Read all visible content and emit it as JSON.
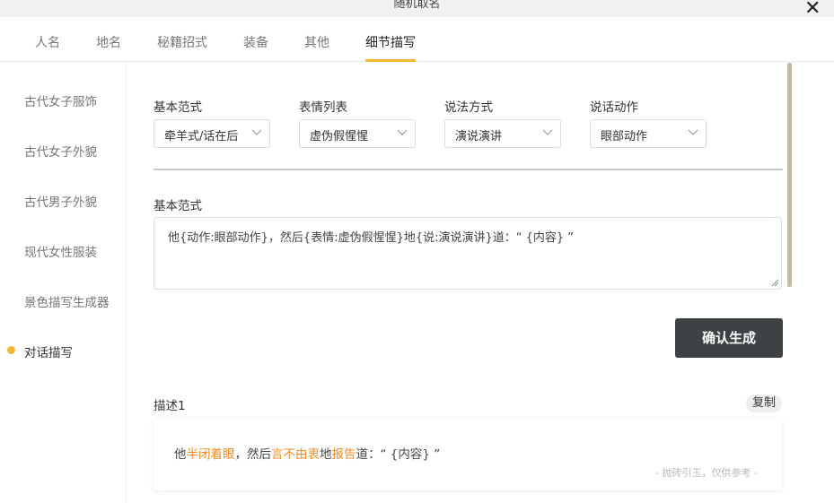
{
  "window": {
    "title": "随机取名",
    "close_glyph": "✕"
  },
  "tabs": [
    {
      "label": "人名"
    },
    {
      "label": "地名"
    },
    {
      "label": "秘籍招式"
    },
    {
      "label": "装备"
    },
    {
      "label": "其他"
    },
    {
      "label": "细节描写",
      "active": true
    }
  ],
  "sidebar": {
    "items": [
      {
        "label": "古代女子服饰"
      },
      {
        "label": "古代女子外貌"
      },
      {
        "label": "古代男子外貌"
      },
      {
        "label": "现代女性服装"
      },
      {
        "label": "景色描写生成器"
      },
      {
        "label": "对话描写",
        "active": true
      }
    ]
  },
  "form": {
    "fields": [
      {
        "label": "基本范式",
        "value": "牵羊式/话在后"
      },
      {
        "label": "表情列表",
        "value": "虚伪假惺惺"
      },
      {
        "label": "说法方式",
        "value": "演说演讲"
      },
      {
        "label": "说话动作",
        "value": "眼部动作"
      }
    ],
    "template_label": "基本范式",
    "template_value": "他{动作:眼部动作}，然后{表情:虚伪假惺惺}地{说:演说演讲}道：“ {内容} ”",
    "confirm_label": "确认生成"
  },
  "result": {
    "title": "描述1",
    "copy_label": "复制",
    "segments": [
      {
        "text": "他",
        "highlight": false
      },
      {
        "text": "半闭着眼",
        "highlight": true
      },
      {
        "text": "，然后",
        "highlight": false
      },
      {
        "text": "言不由衷",
        "highlight": true
      },
      {
        "text": "地",
        "highlight": false
      },
      {
        "text": "报告",
        "highlight": true
      },
      {
        "text": "道：“ {内容} ”",
        "highlight": false
      }
    ],
    "disclaimer": "- 抛砖引玉，仅供参考 -"
  },
  "colors": {
    "accent": "#f5b72f",
    "highlight": "#f08b20",
    "button_bg": "#3d4245"
  }
}
